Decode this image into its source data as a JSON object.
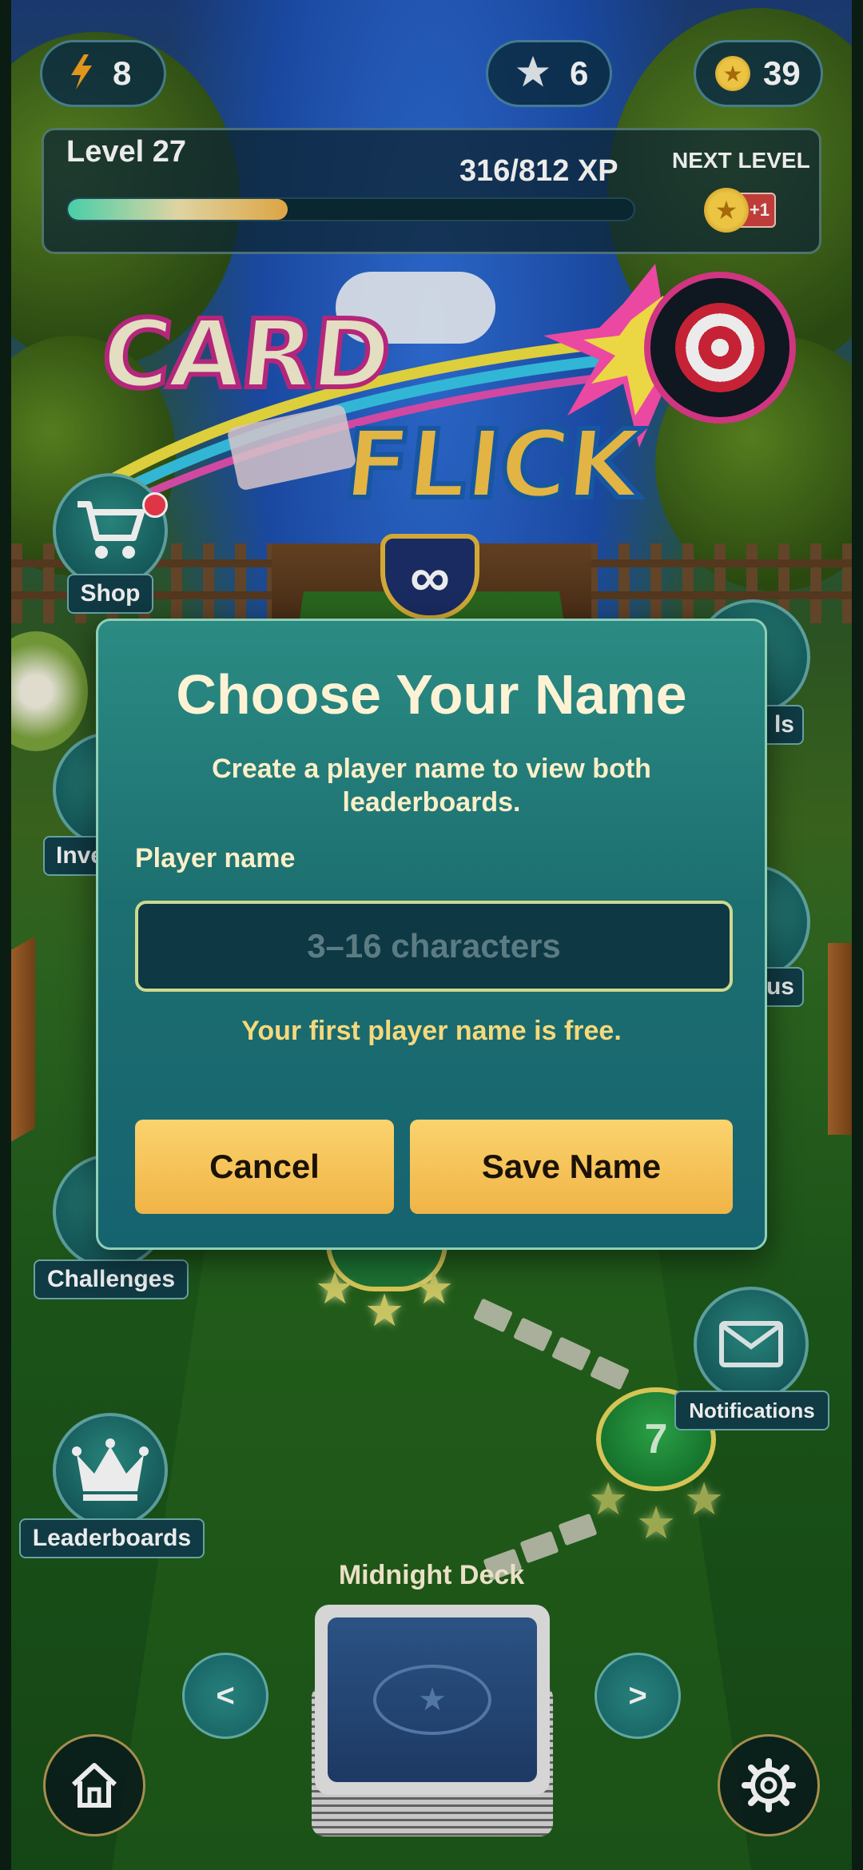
{
  "stats": {
    "energy": "8",
    "stars": "6",
    "coins": "39"
  },
  "level": {
    "title": "Level 27",
    "xp_text": "316/812 XP",
    "xp_progress": 0.389,
    "next_label": "NEXT LEVEL",
    "reward_badge": "+1"
  },
  "logo": {
    "line1": "CARD",
    "line2": "FLICK"
  },
  "nav": {
    "shop": "Shop",
    "inventory": "Inve",
    "levels": "ls",
    "bonus": "us",
    "challenges": "Challenges",
    "notifications": "Notifications",
    "leaderboards": "Leaderboards"
  },
  "modal": {
    "title": "Choose Your Name",
    "subtitle": "Create a player name to view both leaderboards.",
    "field_label": "Player name",
    "placeholder": "3–16 characters",
    "note": "Your first player name is free.",
    "cancel": "Cancel",
    "save": "Save Name"
  },
  "path": {
    "current_level": "7"
  },
  "deck": {
    "name": "Midnight Deck",
    "prev": "<",
    "next": ">"
  },
  "icons": {
    "energy": "lightning-icon",
    "star": "star-icon",
    "coin": "coin-icon",
    "shop": "cart-icon",
    "notifications": "envelope-icon",
    "leaderboards": "crown-icon",
    "home": "home-icon",
    "settings": "gear-icon"
  }
}
